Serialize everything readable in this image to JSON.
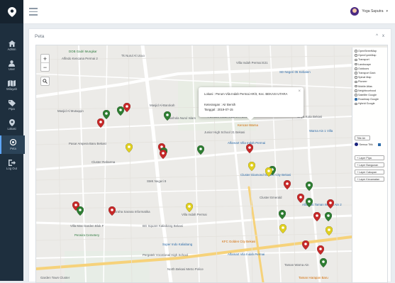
{
  "sidebar": {
    "items": [
      {
        "label": "Admin",
        "icon": "home-icon"
      },
      {
        "label": "User",
        "icon": "user-icon"
      },
      {
        "label": "Wilayah",
        "icon": "map-icon"
      },
      {
        "label": "Pipa",
        "icon": "tag-icon"
      },
      {
        "label": "Lokasi",
        "icon": "location-pin-icon"
      },
      {
        "label": "Peta",
        "icon": "map-marker-icon"
      },
      {
        "label": "Log Out",
        "icon": "logout-icon"
      }
    ]
  },
  "topbar": {
    "user_name": "Yoga Saputra"
  },
  "card": {
    "title": "Peta",
    "tools": [
      "^",
      "x"
    ]
  },
  "map": {
    "zoom_in": "+",
    "zoom_out": "−",
    "popup": {
      "lokasi": "Lokasi : Perum Vila Indah Permai AR/3, Kec. BEKASI UTARA",
      "keterangan": "Keterangan : Air Bersih",
      "tanggal": "Tanggal : 2019-07-15"
    },
    "labels": [
      {
        "text": "DOB Gadri Mungkar"
      },
      {
        "text": "Alfindo Kencana Permai 2"
      },
      {
        "text": "Tk Nurul Al Ucuo"
      },
      {
        "text": "Villa Indah Permai E21"
      },
      {
        "text": "SD Negeri 05 Kebalen"
      },
      {
        "text": "Masjid Al-Barokah"
      },
      {
        "text": "Masjid Al Mutaqqin"
      },
      {
        "text": "Mushola Nurul Islam"
      },
      {
        "text": "PERUM VILLA INDAH PERMAI"
      },
      {
        "text": "Griya Kota Bekasi"
      },
      {
        "text": "Kencan Warna"
      },
      {
        "text": "Junior High School 21 Bekasi"
      },
      {
        "text": "Alfamart Villa Indah Permai"
      },
      {
        "text": "Pasar Ampera Baru Bekasi"
      },
      {
        "text": "Warna Ain 1 Villa"
      },
      {
        "text": "Cluster Raharma"
      },
      {
        "text": "SMK Negeri 9"
      },
      {
        "text": "Cluster Diamond Golden City Bekasi"
      },
      {
        "text": "Cluster Emerald"
      },
      {
        "text": "Alfamart Taman Warna Ain 2"
      },
      {
        "text": "Villa Mas Garden Blok F"
      },
      {
        "text": "Graha Sarana Informatika"
      },
      {
        "text": "Villa Indah Permai"
      },
      {
        "text": "BG Square Kaliabang Bekasi"
      },
      {
        "text": "Perwira Cemetery"
      },
      {
        "text": "Super Indo Kaliabang"
      },
      {
        "text": "KFC Golden City Bekasi"
      },
      {
        "text": "Pergatek Vocational High School"
      },
      {
        "text": "Alfamart Vila Indah Permai"
      },
      {
        "text": "North Bekasi Metro Police"
      },
      {
        "text": "Taman Warna Ain"
      },
      {
        "text": "Garden Town Cluster"
      },
      {
        "text": "Taman Harapan Baru"
      }
    ],
    "markers": [
      {
        "color": "#c62828"
      },
      {
        "color": "#2e7d32"
      },
      {
        "color": "#2e7d32"
      },
      {
        "color": "#c62828"
      },
      {
        "color": "#c62828"
      },
      {
        "color": "#2e7d32"
      },
      {
        "color": "#e0d020"
      },
      {
        "color": "#2e7d32"
      },
      {
        "color": "#c62828"
      },
      {
        "color": "#2e7d32"
      },
      {
        "color": "#c62828"
      },
      {
        "color": "#e0d020"
      },
      {
        "color": "#2e7d32"
      },
      {
        "color": "#c62828"
      },
      {
        "color": "#2e7d32"
      },
      {
        "color": "#e0d020"
      },
      {
        "color": "#c62828"
      },
      {
        "color": "#2e7d32"
      },
      {
        "color": "#c62828"
      },
      {
        "color": "#c62828"
      },
      {
        "color": "#2e7d32"
      },
      {
        "color": "#e0d020"
      },
      {
        "color": "#c62828"
      },
      {
        "color": "#2e7d32"
      },
      {
        "color": "#e0d020"
      },
      {
        "color": "#c62828"
      },
      {
        "color": "#2e7d32"
      },
      {
        "color": "#c62828"
      },
      {
        "color": "#c62828"
      },
      {
        "color": "#2e7d32"
      },
      {
        "color": "#e0d020"
      },
      {
        "color": "#2e7d32"
      }
    ],
    "layer_control": {
      "base_layers": [
        "OpenStreetMap",
        "OpenCycleMap",
        "Transport",
        "Landscape",
        "Outdoors",
        "Transport Dark",
        "Spinal Map",
        "Pioneer",
        "Mobile Atlas",
        "Neighbourhood",
        "Satellite Google",
        "Roadmap Google",
        "Hybrid Google"
      ],
      "selected_base": "Roadmap Google",
      "title_row": "Title Air",
      "semua_titik": "Semua Titik",
      "buttons": [
        "+ Layer Pipa",
        "+ Layer Bangunan",
        "+ Layer Cakupan",
        "+ Layer Kecamatan"
      ]
    }
  },
  "colors": {
    "sidebar": "#1e2f3e",
    "marker_red": "#c62828",
    "marker_green": "#2e7d32",
    "marker_yellow": "#e0d020",
    "accent": "#2b6aa8"
  }
}
